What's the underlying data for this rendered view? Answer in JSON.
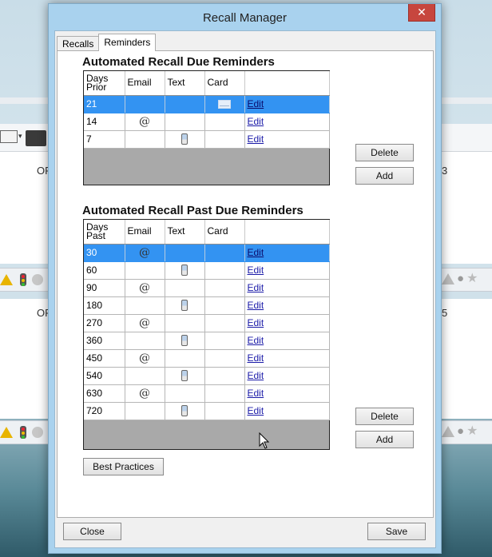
{
  "window": {
    "title": "Recall Manager",
    "close_glyph": "✕"
  },
  "tabs": [
    {
      "label": "Recalls",
      "active": false
    },
    {
      "label": "Reminders",
      "active": true
    }
  ],
  "due_reminders": {
    "title": "Automated Recall Due Reminders",
    "columns": [
      "Days Prior",
      "Email",
      "Text",
      "Card",
      ""
    ],
    "rows": [
      {
        "days": "21",
        "email": false,
        "text": false,
        "card": true,
        "edit": "Edit",
        "selected": true
      },
      {
        "days": "14",
        "email": true,
        "text": false,
        "card": false,
        "edit": "Edit",
        "selected": false
      },
      {
        "days": "7",
        "email": false,
        "text": true,
        "card": false,
        "edit": "Edit",
        "selected": false
      }
    ],
    "delete_label": "Delete",
    "add_label": "Add"
  },
  "past_due_reminders": {
    "title": "Automated Recall Past Due Reminders",
    "columns": [
      "Days Past",
      "Email",
      "Text",
      "Card",
      ""
    ],
    "rows": [
      {
        "days": "30",
        "email": true,
        "text": false,
        "card": false,
        "edit": "Edit",
        "selected": true
      },
      {
        "days": "60",
        "email": false,
        "text": true,
        "card": false,
        "edit": "Edit",
        "selected": false
      },
      {
        "days": "90",
        "email": true,
        "text": false,
        "card": false,
        "edit": "Edit",
        "selected": false
      },
      {
        "days": "180",
        "email": false,
        "text": true,
        "card": false,
        "edit": "Edit",
        "selected": false
      },
      {
        "days": "270",
        "email": true,
        "text": false,
        "card": false,
        "edit": "Edit",
        "selected": false
      },
      {
        "days": "360",
        "email": false,
        "text": true,
        "card": false,
        "edit": "Edit",
        "selected": false
      },
      {
        "days": "450",
        "email": true,
        "text": false,
        "card": false,
        "edit": "Edit",
        "selected": false
      },
      {
        "days": "540",
        "email": false,
        "text": true,
        "card": false,
        "edit": "Edit",
        "selected": false
      },
      {
        "days": "630",
        "email": true,
        "text": false,
        "card": false,
        "edit": "Edit",
        "selected": false
      },
      {
        "days": "720",
        "email": false,
        "text": true,
        "card": false,
        "edit": "Edit",
        "selected": false
      }
    ],
    "delete_label": "Delete",
    "add_label": "Add"
  },
  "best_practices_label": "Best Practices",
  "footer": {
    "close_label": "Close",
    "save_label": "Save"
  },
  "icons": {
    "email": "at-sign-icon",
    "text": "mobile-phone-icon",
    "card": "envelope-icon"
  },
  "background_app": {
    "row1_left": "OF",
    "row1_right": "3",
    "row2_left": "OF",
    "row2_right": "5"
  },
  "colors": {
    "selection": "#3393f2",
    "close_button": "#c7463e",
    "dialog_frame": "#a9d2ee"
  }
}
